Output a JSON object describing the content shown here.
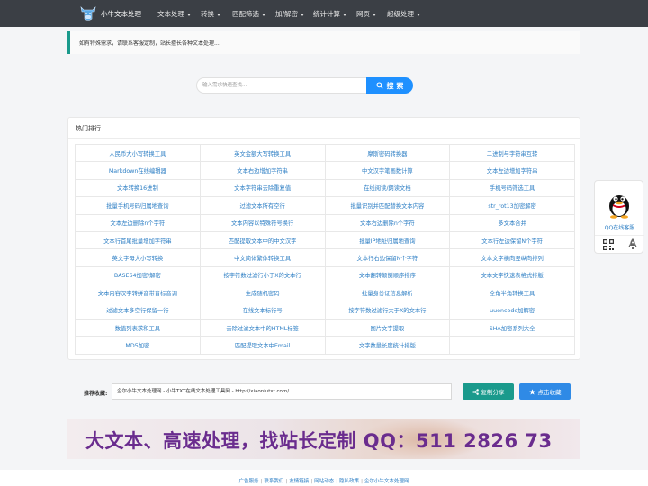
{
  "navbar": {
    "brand": "小牛文本处理",
    "items": [
      {
        "label": "文本处理",
        "caret": true
      },
      {
        "label": "转换",
        "caret": true
      },
      {
        "label": "匹配筛选",
        "caret": true
      },
      {
        "label": "加/解密",
        "caret": true
      },
      {
        "label": "统计计算",
        "caret": true
      },
      {
        "label": "网页",
        "caret": true
      },
      {
        "label": "超级处理",
        "caret": true
      }
    ]
  },
  "notice": "如有特殊需求，请联系客服定制，站长擅长各种文本处理...",
  "search": {
    "placeholder": "输入需求快速查找...",
    "button": "搜 索"
  },
  "hot": {
    "title": "热门排行",
    "rows": [
      [
        "人民币大小写转换工具",
        "英文金额大写转换工具",
        "摩斯密码转换器",
        "二进制与字符串互转"
      ],
      [
        "Markdown在线编辑器",
        "文本右边增加字符串",
        "中文汉字笔画数计算",
        "文本左边增加字符串"
      ],
      [
        "文本转换16进制",
        "文本字符串去除重复值",
        "在线阅读/朗读文档",
        "手机号码筛选工具"
      ],
      [
        "批量手机号码归属地查询",
        "过滤文本所有空行",
        "批量识别并匹配替换文本内容",
        "str_rot13加密解密"
      ],
      [
        "文本左边删除n个字符",
        "文本内容以特殊符号换行",
        "文本右边删除n个字符",
        "多文本合并"
      ],
      [
        "文本行首尾批量增加字符串",
        "匹配提取文本中的中文汉字",
        "批量IP地址归属地查询",
        "文本行左边保留N个字符"
      ],
      [
        "英文字母大小写转换",
        "中文简体繁体转换工具",
        "文本行右边保留N个字符",
        "文本文字横向竖纵向排列"
      ],
      [
        "BASE64加密/解密",
        "按字符数过滤行小于X的文本行",
        "文本翻转颠倒顺序排序",
        "文本文字快速表格式排版"
      ],
      [
        "文本内容汉字转拼音带音标音调",
        "生成随机密码",
        "批量身份证信息解析",
        "全角半角转换工具"
      ],
      [
        "过滤文本多空行保留一行",
        "在线文本标行号",
        "按字符数过滤行大于X的文本行",
        "uuencode加解密"
      ],
      [
        "数值列表求和工具",
        "去除过滤文本中的HTML标签",
        "图片文字提取",
        "SHA加密系列大全"
      ],
      [
        "MD5加密",
        "匹配提取文本中Email",
        "文字数量长度统计排版",
        ""
      ]
    ]
  },
  "qq": {
    "label": "QQ在线客服"
  },
  "bookmark": {
    "label": "推荐收藏:",
    "value": "企尔小牛文本处理网 - 小牛TXT在线文本处理工具网 - http://xiaoniutxt.com/",
    "share_button": "复制分享",
    "fav_button": "点击收藏"
  },
  "banner": {
    "text": "大文本、高速处理，找站长定制 QQ：511 2826 73"
  },
  "footer": {
    "links": [
      "广告服务",
      "联系我们",
      "友情链接",
      "网站动态",
      "隐私政策",
      "企尔小牛文本处理网"
    ]
  },
  "colors": {
    "nav_bg": "#3b3f45",
    "accent_teal": "#1a9a8c",
    "link_blue": "#2c7ec4",
    "search_blue": "#1e90ff",
    "banner_purple": "#6a2c8e"
  }
}
